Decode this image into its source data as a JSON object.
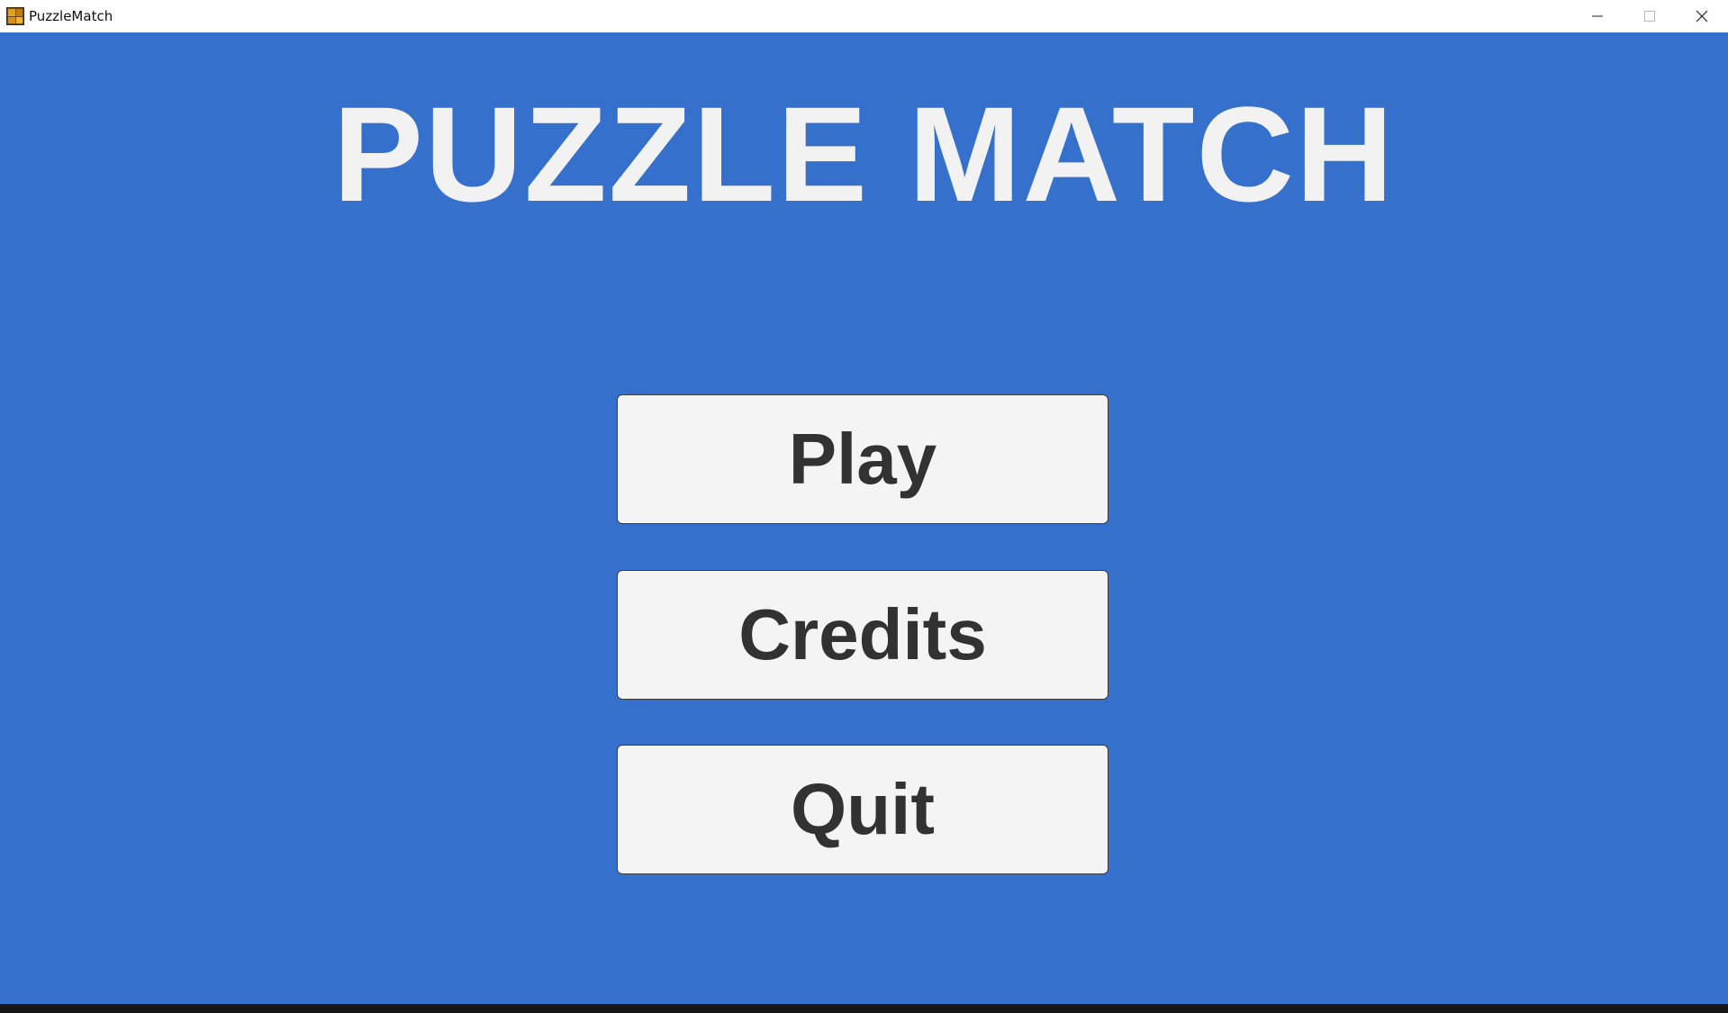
{
  "window": {
    "title": "PuzzleMatch",
    "icon": "puzzle-app-icon",
    "controls": [
      "minimize-icon",
      "maximize-icon",
      "close-icon"
    ]
  },
  "game": {
    "title": "PUZZLE MATCH",
    "background_color": "#3570cc",
    "menu": {
      "play_label": "Play",
      "credits_label": "Credits",
      "quit_label": "Quit"
    }
  }
}
